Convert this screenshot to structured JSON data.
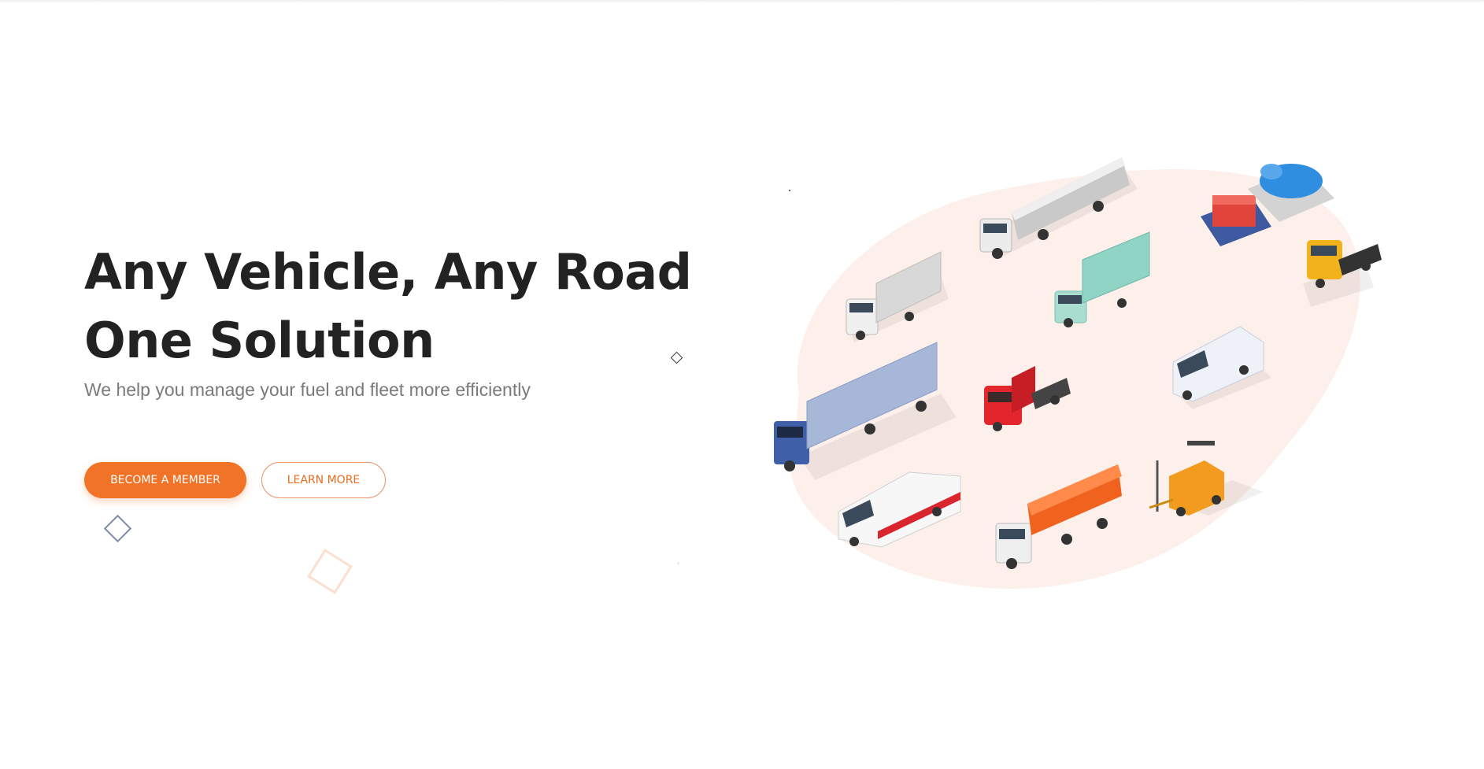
{
  "hero": {
    "title_line1": "Any Vehicle, Any Road",
    "title_line2": "One Solution",
    "subtitle": "We help you manage your fuel and fleet more efficiently"
  },
  "buttons": {
    "primary_label": "BECOME A MEMBER",
    "secondary_label": "LEARN MORE"
  },
  "colors": {
    "accent": "#f07328",
    "title": "#222222",
    "subtitle": "#7a7a7a",
    "blob": "#fdf0ea"
  },
  "illustration": {
    "icons": [
      "tanker-truck-icon",
      "box-truck-icon",
      "teal-truck-icon",
      "generator-icon",
      "water-tank-icon",
      "yellow-tractor-icon",
      "blue-semi-truck-icon",
      "red-tractor-icon",
      "van-icon",
      "ambulance-icon",
      "dump-truck-icon",
      "forklift-icon"
    ]
  }
}
